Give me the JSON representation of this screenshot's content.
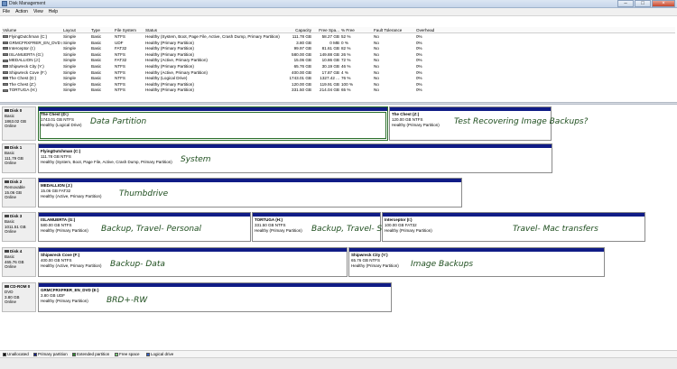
{
  "window": {
    "title": "Disk Management"
  },
  "menu": [
    "File",
    "Action",
    "View",
    "Help"
  ],
  "columns": [
    "Volume",
    "Layout",
    "Type",
    "File System",
    "Status",
    "Capacity",
    "Free Spa...",
    "% Free",
    "Fault Tolerance",
    "Overhead"
  ],
  "volumes": [
    [
      "FlyingDutchman (C:)",
      "Simple",
      "Basic",
      "NTFS",
      "Healthy (System, Boot, Page File, Active, Crash Dump, Primary Partition)",
      "111.78 GB",
      "58.27 GB",
      "52 %",
      "No",
      "0%"
    ],
    [
      "GRMCFRXFRER_EN_DVD (E:)",
      "Simple",
      "Basic",
      "UDF",
      "Healthy (Primary Partition)",
      "3.80 GB",
      "0 MB",
      "0 %",
      "No",
      "0%"
    ],
    [
      "Interceptor (I:)",
      "Simple",
      "Basic",
      "FAT32",
      "Healthy (Primary Partition)",
      "99.97 GB",
      "81.61 GB",
      "82 %",
      "No",
      "0%"
    ],
    [
      "ISLAMUERTA (G:)",
      "Simple",
      "Basic",
      "NTFS",
      "Healthy (Primary Partition)",
      "580.00 GB",
      "149.88 GB",
      "26 %",
      "No",
      "0%"
    ],
    [
      "MEDALLION (J:)",
      "Simple",
      "Basic",
      "FAT32",
      "Healthy (Active, Primary Partition)",
      "15.06 GB",
      "10.86 GB",
      "72 %",
      "No",
      "0%"
    ],
    [
      "Shipwreck City (Y:)",
      "Simple",
      "Basic",
      "NTFS",
      "Healthy (Primary Partition)",
      "65.76 GB",
      "30.19 GB",
      "46 %",
      "No",
      "0%"
    ],
    [
      "Shipwreck Cove (F:)",
      "Simple",
      "Basic",
      "NTFS",
      "Healthy (Active, Primary Partition)",
      "400.00 GB",
      "17.87 GB",
      "4 %",
      "No",
      "0%"
    ],
    [
      "The Chest (D:)",
      "Simple",
      "Basic",
      "NTFS",
      "Healthy (Logical Drive)",
      "1743.01 GB",
      "1327.42 ...",
      "76 %",
      "No",
      "0%"
    ],
    [
      "The Chest (Z:)",
      "Simple",
      "Basic",
      "NTFS",
      "Healthy (Primary Partition)",
      "120.00 GB",
      "119.91 GB",
      "100 %",
      "No",
      "0%"
    ],
    [
      "TORTUGA (H:)",
      "Simple",
      "Basic",
      "NTFS",
      "Healthy (Primary Partition)",
      "331.50 GB",
      "214.04 GB",
      "65 %",
      "No",
      "0%"
    ]
  ],
  "disks": [
    {
      "name": "Disk 0",
      "kind": "Basic",
      "size": "1863.02 GB",
      "status": "Online",
      "partitions": [
        {
          "name": "The Chest (D:)",
          "size": "1743.01 GB NTFS",
          "status": "Healthy (Logical Drive)",
          "note": "Data Partition"
        },
        {
          "name": "The Chest (Z:)",
          "size": "120.00 GB NTFS",
          "status": "Healthy (Primary Partition)",
          "note": "Test Recovering Image Backups?"
        }
      ]
    },
    {
      "name": "Disk 1",
      "kind": "Basic",
      "size": "111.79 GB",
      "status": "Online",
      "partitions": [
        {
          "name": "FlyingDutchman (C:)",
          "size": "111.78 GB NTFS",
          "status": "Healthy (System, Boot, Page File, Active, Crash Dump, Primary Partition)",
          "note": "System"
        }
      ]
    },
    {
      "name": "Disk 2",
      "kind": "Removable",
      "size": "15.06 GB",
      "status": "Online",
      "partitions": [
        {
          "name": "MEDALLION (J:)",
          "size": "15.06 GB FAT32",
          "status": "Healthy (Active, Primary Partition)",
          "note": "Thumbdrive"
        }
      ]
    },
    {
      "name": "Disk 3",
      "kind": "Basic",
      "size": "1011.51 GB",
      "status": "Online",
      "partitions": [
        {
          "name": "ISLAMUERTA (G:)",
          "size": "580.00 GB NTFS",
          "status": "Healthy (Primary Partition)",
          "note": "Backup, Travel- Personal"
        },
        {
          "name": "TORTUGA (H:)",
          "size": "331.50 GB NTFS",
          "status": "Healthy (Primary Partition)",
          "note": "Backup, Travel- School/Work"
        },
        {
          "name": "Interceptor (I:)",
          "size": "100.00 GB FAT32",
          "status": "Healthy (Primary Partition)",
          "note": "Travel- Mac transfers"
        }
      ]
    },
    {
      "name": "Disk 4",
      "kind": "Basic",
      "size": "465.76 GB",
      "status": "Online",
      "partitions": [
        {
          "name": "Shipwreck Cove (F:)",
          "size": "400.00 GB NTFS",
          "status": "Healthy (Active, Primary Partition)",
          "note": "Backup- Data"
        },
        {
          "name": "Shipwreck City (Y:)",
          "size": "65.76 GB NTFS",
          "status": "Healthy (Primary Partition)",
          "note": "Image Backups"
        }
      ]
    },
    {
      "name": "CD-ROM 0",
      "kind": "DVD",
      "size": "3.80 GB",
      "status": "Online",
      "partitions": [
        {
          "name": "GRMCFRXFRER_EN_DVD (E:)",
          "size": "3.80 GB UDF",
          "status": "Healthy (Primary Partition)",
          "note": "BRD+-RW"
        }
      ]
    }
  ],
  "legend": [
    {
      "label": "Unallocated",
      "color": "#000000"
    },
    {
      "label": "Primary partition",
      "color": "#101c86"
    },
    {
      "label": "Extended partition",
      "color": "#2e8b2e"
    },
    {
      "label": "Free space",
      "color": "#7fd87f"
    },
    {
      "label": "Logical drive",
      "color": "#2f5fd0"
    }
  ],
  "colors": {
    "partition_bar": "#101c86",
    "annotation": "#1d4d1d"
  }
}
